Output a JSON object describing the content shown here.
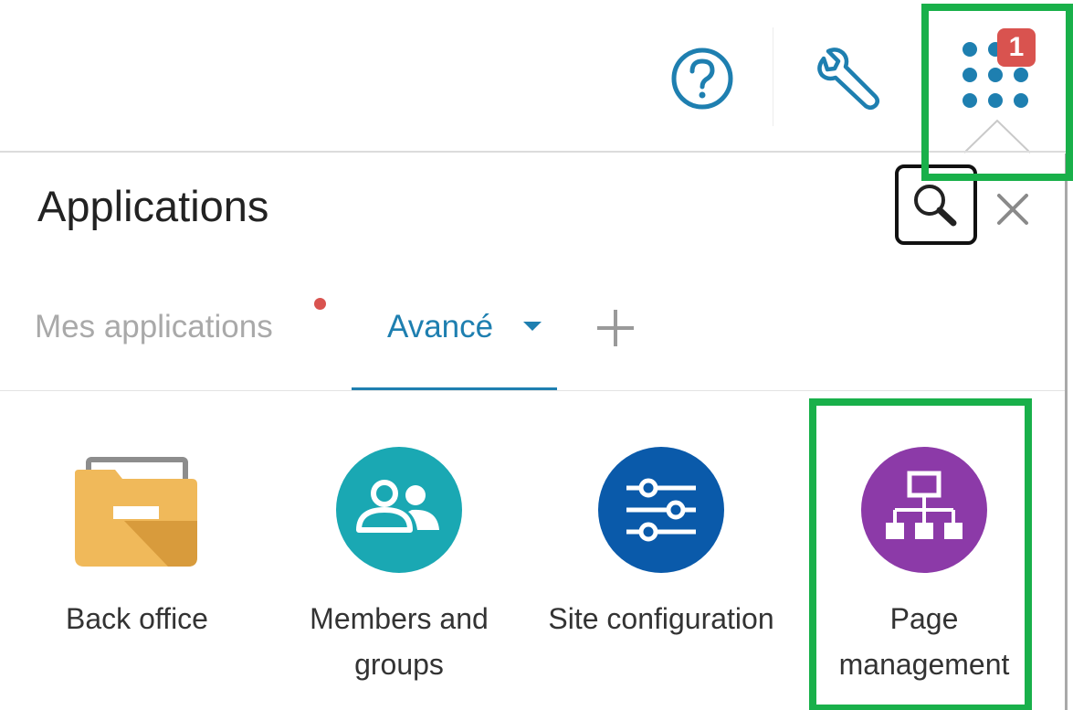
{
  "toolbar": {
    "help_icon": "help-circle-icon",
    "tools_icon": "wrench-icon",
    "apps_icon": "grid-dots-icon",
    "apps_badge": "1"
  },
  "panel": {
    "title": "Applications",
    "search_icon": "search-icon",
    "close_icon": "close-icon"
  },
  "tabs": [
    {
      "label": "Mes applications",
      "active": false,
      "has_notification": true
    },
    {
      "label": "Avancé",
      "active": true,
      "has_dropdown": true
    }
  ],
  "add_tab_icon": "plus-icon",
  "apps": [
    {
      "label": "Back office",
      "icon": "folder-icon",
      "color": "#f0b95a"
    },
    {
      "label": "Members and groups",
      "icon": "users-icon",
      "color": "#1aa8b3"
    },
    {
      "label": "Site configuration",
      "icon": "sliders-icon",
      "color": "#0a5aaa"
    },
    {
      "label": "Page management",
      "icon": "sitemap-icon",
      "color": "#8c3aa8"
    }
  ],
  "colors": {
    "accent": "#1e7fb0",
    "badge": "#d9534f",
    "highlight": "#19b04a",
    "inactive_tab": "#a9a9a9"
  }
}
